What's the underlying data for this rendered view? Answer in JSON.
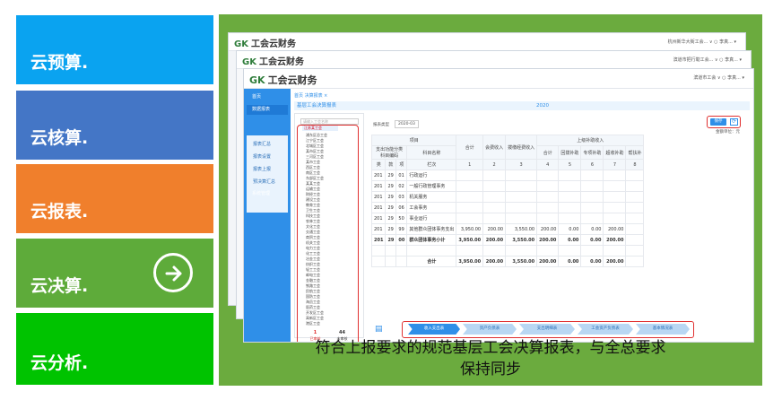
{
  "menu": [
    {
      "label": "云预算."
    },
    {
      "label": "云核算."
    },
    {
      "label": "云报表."
    },
    {
      "label": "云决算."
    },
    {
      "label": "云分析."
    }
  ],
  "colors": {
    "tile1": "#0aa3f0",
    "tile2": "#4476c6",
    "tile3": "#f07f2c",
    "tile4": "#5eab3a",
    "tile5": "#00c300",
    "panel": "#6bab3e",
    "accent": "#2f8fe8",
    "highlight": "#e03030"
  },
  "caption": {
    "line1": "符合上报要求的规范基层工会决算报表，与全总要求",
    "line2": "保持同步"
  },
  "app": {
    "logo_mark": "GK",
    "name": "工会云财务",
    "win1_right": "杭州新华大街工会... ∨  ○  李真... ▾",
    "win2_right": "滨道市把行勒工会...  ∨  ○  李真... ▾",
    "win3_right": "滨道市工会  ∨  ○  李真... ▾",
    "sidebar": {
      "home": "首页",
      "data_mgmt": "数据报表",
      "sub_items": [
        "报表汇总",
        "报表设置",
        "报表上报",
        "预决算汇总"
      ],
      "system": "系统管理"
    },
    "top_strip": "首页   决算报表 ×",
    "report_title": "基层工会决算报表",
    "report_year": "2020",
    "search_placeholder": "请输入工会名称",
    "tree": {
      "selected": "江苏某工会",
      "items": [
        "浦东区总工会",
        "江宁区工会",
        "北城区工会",
        "某市区工会",
        "三河区工会",
        "某市工会",
        "西区工会",
        "南区工会",
        "东部区工会",
        "某某工会",
        "运输工会",
        "财经工会",
        "建设工会",
        "教育工会",
        "卫生工会",
        "科技工会",
        "农林工会",
        "文化工会",
        "交通工会",
        "商贸工会",
        "机关工会",
        "电力工会",
        "化工工会",
        "冶金工会",
        "纺织工会",
        "轻工工会",
        "邮电工会",
        "金融工会",
        "铁路工会",
        "民航工会",
        "国防工会",
        "海员工会",
        "医药工会",
        "开发区工会",
        "高新区工会",
        "港区工会"
      ],
      "footer": {
        "count1": "1",
        "label1": "已审核",
        "count2": "44",
        "label2": "未审核"
      }
    },
    "content": {
      "report_type": "报表类型",
      "period": "2020-03",
      "unit_hint": "金额单位：元",
      "btn_save": "保存",
      "btn_refresh": "⟳"
    },
    "table": {
      "group_header": "项目",
      "sub_header1": "支出功能分类科目编码",
      "sub_header2": "科目名称",
      "col_headers": [
        "合计",
        "会费收入",
        "拨缴经费收入"
      ],
      "right_group": "上级补助收入",
      "right_cols": [
        "合计",
        "回拨补助",
        "专项补助",
        "超收补助",
        "帮扶补"
      ],
      "code_heads": [
        "类",
        "款",
        "项"
      ],
      "col_label": "栏次",
      "col_index": [
        "1",
        "2",
        "3",
        "4",
        "5",
        "6",
        "7",
        "8"
      ],
      "rows": [
        {
          "c1": "201",
          "c2": "29",
          "c3": "01",
          "name": "行政运行",
          "v": [
            "",
            "",
            "",
            "",
            "",
            "",
            "",
            ""
          ]
        },
        {
          "c1": "201",
          "c2": "29",
          "c3": "02",
          "name": "一般行政管理事务",
          "v": [
            "",
            "",
            "",
            "",
            "",
            "",
            "",
            ""
          ]
        },
        {
          "c1": "201",
          "c2": "29",
          "c3": "03",
          "name": "机关服务",
          "v": [
            "",
            "",
            "",
            "",
            "",
            "",
            "",
            ""
          ]
        },
        {
          "c1": "201",
          "c2": "29",
          "c3": "06",
          "name": "工会事务",
          "v": [
            "",
            "",
            "",
            "",
            "",
            "",
            "",
            ""
          ]
        },
        {
          "c1": "201",
          "c2": "29",
          "c3": "50",
          "name": "事业运行",
          "v": [
            "",
            "",
            "",
            "",
            "",
            "",
            "",
            ""
          ]
        },
        {
          "c1": "201",
          "c2": "29",
          "c3": "99",
          "name": "其他群众团体事务支出",
          "v": [
            "3,950.00",
            "200.00",
            "3,550.00",
            "200.00",
            "0.00",
            "0.00",
            "200.00",
            ""
          ]
        },
        {
          "c1": "201",
          "c2": "29",
          "c3": "00",
          "name": "群众团体事务小计",
          "v": [
            "3,950.00",
            "200.00",
            "3,550.00",
            "200.00",
            "0.00",
            "0.00",
            "200.00",
            ""
          ]
        },
        {
          "c1": "",
          "c2": "",
          "c3": "",
          "name": "",
          "v": [
            "",
            "",
            "",
            "",
            "",
            "",
            "",
            ""
          ]
        },
        {
          "c1": "",
          "c2": "",
          "c3": "",
          "name": "合计",
          "v": [
            "3,950.00",
            "200.00",
            "3,550.00",
            "200.00",
            "0.00",
            "0.00",
            "200.00",
            ""
          ]
        }
      ]
    },
    "bottom_tabs": [
      "收入支出表",
      "资产负债表",
      "支出明细表",
      "工会资产负债表",
      "基本情况表"
    ]
  }
}
